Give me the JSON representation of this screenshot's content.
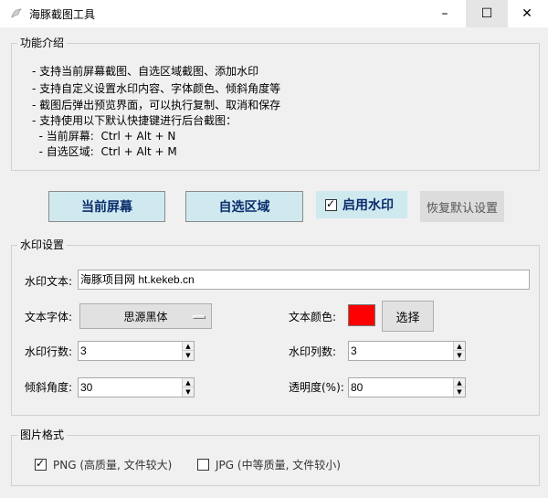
{
  "window": {
    "title": "海豚截图工具",
    "controls": {
      "minimize": "–",
      "maximize": "☐",
      "close": "✕"
    }
  },
  "intro": {
    "legend": "功能介绍",
    "lines": [
      "- 支持当前屏幕截图、自选区域截图、添加水印",
      "- 支持自定义设置水印内容、字体颜色、倾斜角度等",
      "- 截图后弹出预览界面，可以执行复制、取消和保存",
      "- 支持使用以下默认快捷键进行后台截图：",
      "  - 当前屏幕:  Ctrl + Alt + N",
      "  - 自选区域:  Ctrl + Alt + M"
    ]
  },
  "actions": {
    "current_screen": "当前屏幕",
    "custom_region": "自选区域",
    "enable_watermark": {
      "label": "启用水印",
      "checked": true
    },
    "reset_defaults": "恢复默认设置"
  },
  "watermark": {
    "legend": "水印设置",
    "text_label": "水印文本:",
    "text_value": "海豚项目网 ht.kekeb.cn",
    "font_label": "文本字体:",
    "font_value": "思源黑体",
    "color_label": "文本颜色:",
    "color_value": "#ff0000",
    "choose_label": "选择",
    "rows_label": "水印行数:",
    "rows_value": "3",
    "cols_label": "水印列数:",
    "cols_value": "3",
    "angle_label": "倾斜角度:",
    "angle_value": "30",
    "opacity_label": "透明度(%):",
    "opacity_value": "80"
  },
  "format": {
    "legend": "图片格式",
    "png": {
      "label": "PNG (高质量, 文件较大)",
      "checked": true
    },
    "jpg": {
      "label": "JPG (中等质量, 文件较小)",
      "checked": false
    }
  },
  "icons": {
    "app": "dolphin-icon",
    "checked": "✓",
    "spin_up": "▲",
    "spin_down": "▼"
  }
}
